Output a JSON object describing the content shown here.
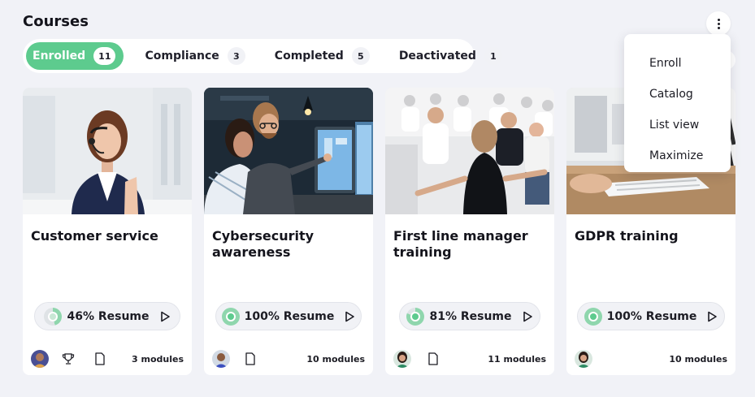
{
  "page": {
    "title": "Courses"
  },
  "tabs": [
    {
      "label": "Enrolled",
      "count": "11",
      "active": true
    },
    {
      "label": "Compliance",
      "count": "3",
      "active": false
    },
    {
      "label": "Completed",
      "count": "5",
      "active": false
    },
    {
      "label": "Deactivated",
      "count": "1",
      "active": false
    }
  ],
  "menu": {
    "items": [
      "Enroll",
      "Catalog",
      "List view",
      "Maximize"
    ]
  },
  "courses": [
    {
      "title": "Customer service",
      "progress_label": "46% Resume",
      "progress": 46,
      "modules": "3 modules",
      "has_trophy": true,
      "image": "photo-headset-agent"
    },
    {
      "title": "Cybersecurity awareness",
      "progress_label": "100% Resume",
      "progress": 100,
      "modules": "10 modules",
      "has_trophy": false,
      "image": "photo-coding-team"
    },
    {
      "title": "First line manager training",
      "progress_label": "81% Resume",
      "progress": 81,
      "modules": "11 modules",
      "has_trophy": false,
      "image": "photo-seminar-audience"
    },
    {
      "title": "GDPR training",
      "progress_label": "100% Resume",
      "progress": 100,
      "modules": "10 modules",
      "has_trophy": false,
      "image": "photo-desk-keyboard"
    }
  ],
  "colors": {
    "accent": "#5dcb8e",
    "background": "#f1f2f7",
    "ring_track": "#dfe3e6"
  }
}
